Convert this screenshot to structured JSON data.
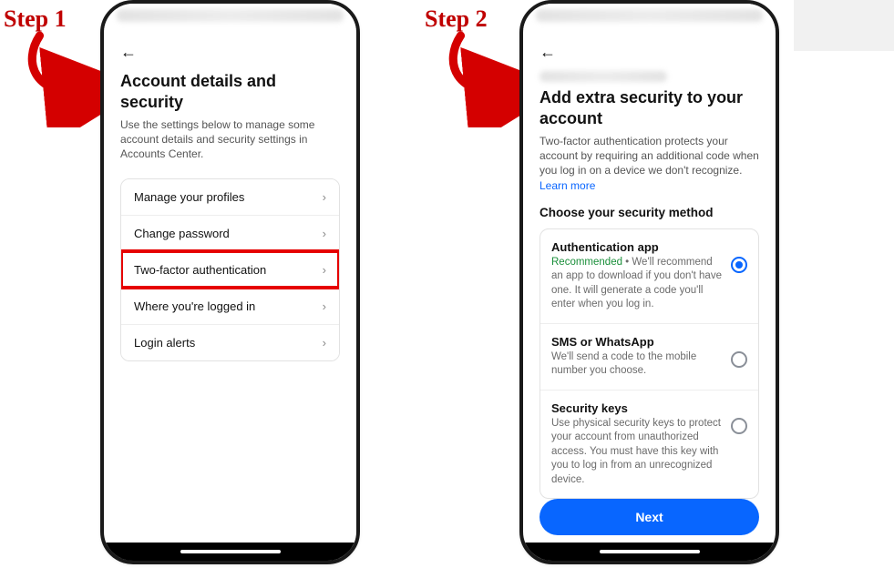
{
  "annotations": {
    "step1_label": "Step 1",
    "step2_label": "Step 2"
  },
  "screen1": {
    "title": "Account details and security",
    "subtitle": "Use the settings below to manage some account details and security settings in Accounts Center.",
    "items": [
      {
        "label": "Manage your profiles"
      },
      {
        "label": "Change password"
      },
      {
        "label": "Two-factor authentication"
      },
      {
        "label": "Where you're logged in"
      },
      {
        "label": "Login alerts"
      }
    ],
    "highlight_index": 2
  },
  "screen2": {
    "title": "Add extra security to your account",
    "description": "Two-factor authentication protects your account by requiring an additional code when you log in on a device we don't recognize.",
    "learn_more": "Learn more",
    "section_title": "Choose your security method",
    "options": [
      {
        "title": "Authentication app",
        "recommended_label": "Recommended",
        "desc": " • We'll recommend an app to download if you don't have one. It will generate a code you'll enter when you log in.",
        "selected": true
      },
      {
        "title": "SMS or WhatsApp",
        "desc": "We'll send a code to the mobile number you choose.",
        "selected": false
      },
      {
        "title": "Security keys",
        "desc": "Use physical security keys to protect your account from unauthorized access. You must have this key with you to log in from an unrecognized device.",
        "selected": false
      }
    ],
    "next_label": "Next"
  }
}
